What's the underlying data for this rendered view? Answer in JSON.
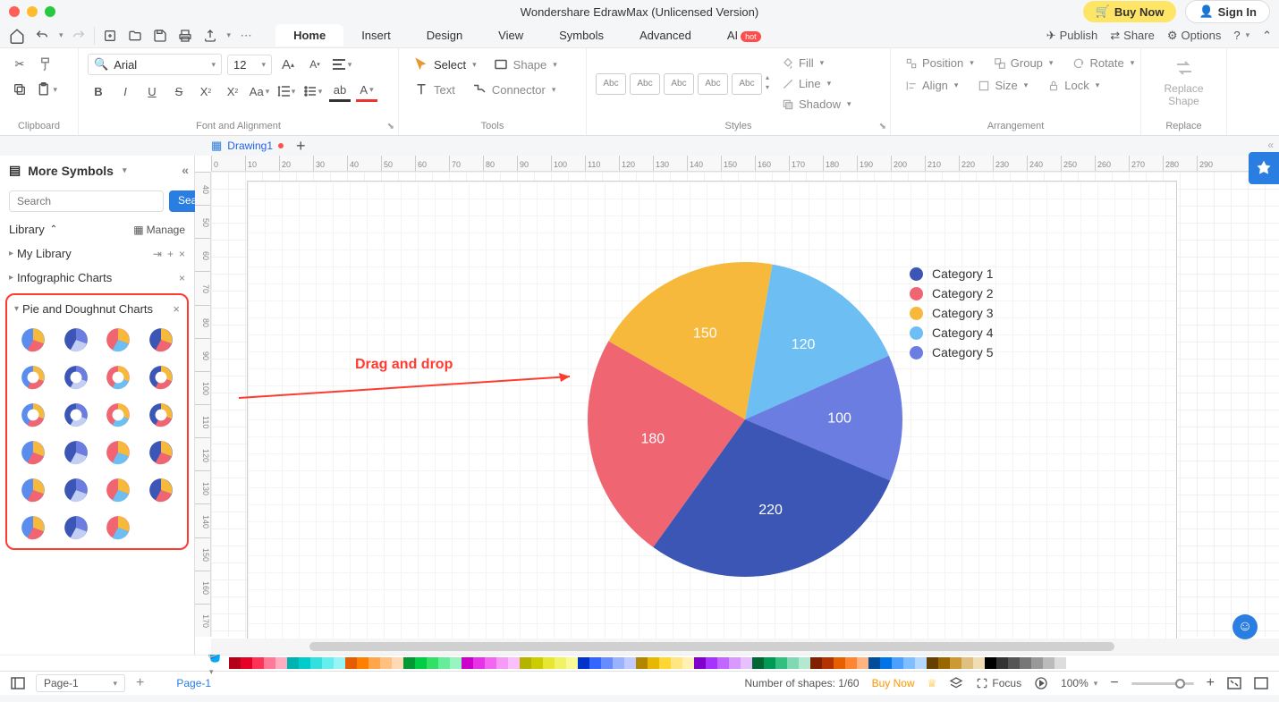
{
  "window": {
    "title": "Wondershare EdrawMax (Unlicensed Version)"
  },
  "titlebar": {
    "buy_now": "Buy Now",
    "sign_in": "Sign In"
  },
  "menubar": {
    "tabs": [
      "Home",
      "Insert",
      "Design",
      "View",
      "Symbols",
      "Advanced",
      "AI"
    ],
    "hot_badge": "hot",
    "right": {
      "publish": "Publish",
      "share": "Share",
      "options": "Options"
    }
  },
  "ribbon": {
    "clipboard_label": "Clipboard",
    "font_alignment_label": "Font and Alignment",
    "tools_label": "Tools",
    "styles_label": "Styles",
    "arrangement_label": "Arrangement",
    "replace_label": "Replace",
    "font_name": "Arial",
    "font_size": "12",
    "select": "Select",
    "shape": "Shape",
    "text": "Text",
    "connector": "Connector",
    "style_swatch": "Abc",
    "fill": "Fill",
    "line": "Line",
    "shadow": "Shadow",
    "position": "Position",
    "group": "Group",
    "rotate": "Rotate",
    "align": "Align",
    "size": "Size",
    "lock": "Lock",
    "replace_shape": "Replace\nShape"
  },
  "doc_tabs": {
    "drawing1": "Drawing1"
  },
  "sidebar": {
    "more_symbols": "More Symbols",
    "search_placeholder": "Search",
    "search_btn": "Search",
    "library": "Library",
    "manage": "Manage",
    "my_library": "My Library",
    "infographic_charts": "Infographic Charts",
    "pie_doughnut": "Pie and Doughnut Charts"
  },
  "ruler_h": [
    "0",
    "10",
    "20",
    "30",
    "40",
    "50",
    "60",
    "70",
    "80",
    "90",
    "100",
    "110",
    "120",
    "130",
    "140",
    "150",
    "160",
    "170",
    "180",
    "190",
    "200",
    "210",
    "220",
    "230",
    "240",
    "250",
    "260",
    "270",
    "280",
    "290"
  ],
  "ruler_v": [
    "40",
    "50",
    "60",
    "70",
    "80",
    "90",
    "100",
    "110",
    "120",
    "130",
    "140",
    "150",
    "160",
    "170"
  ],
  "annotation": {
    "text": "Drag and drop"
  },
  "chart_data": {
    "type": "pie",
    "categories": [
      "Category 1",
      "Category 2",
      "Category 3",
      "Category 4",
      "Category 5"
    ],
    "values": [
      220,
      180,
      150,
      120,
      100
    ],
    "colors": [
      "#3b56b5",
      "#ef6572",
      "#f6b93b",
      "#6cbef3",
      "#6b7de0"
    ],
    "title": "",
    "legend_position": "right"
  },
  "statusbar": {
    "page_selector": "Page-1",
    "page_tab": "Page-1",
    "shapes_count": "Number of shapes: 1/60",
    "buy_now": "Buy Now",
    "focus": "Focus",
    "zoom": "100%"
  }
}
